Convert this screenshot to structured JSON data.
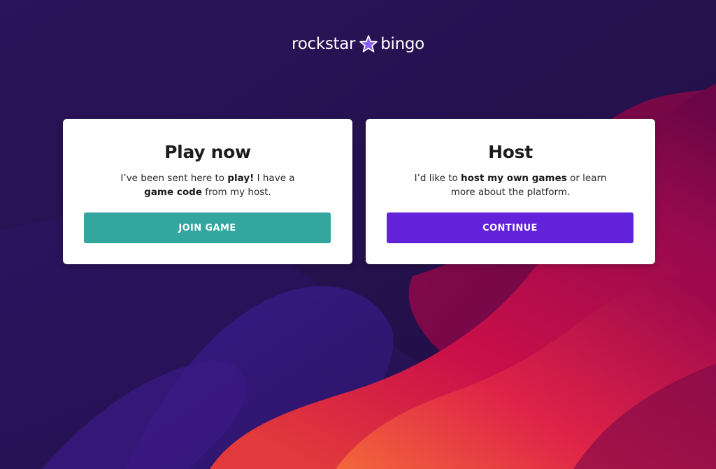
{
  "brand": {
    "name_left": "rockstar",
    "name_right": "bingo",
    "star_color": "#8a5cf6"
  },
  "cards": {
    "play": {
      "title": "Play now",
      "desc_parts": [
        "I’ve been sent here to ",
        "play!",
        " I have a ",
        "game code",
        " from my host."
      ],
      "button_label": "JOIN GAME",
      "button_color": "#33a69e"
    },
    "host": {
      "title": "Host",
      "desc_parts": [
        "I’d like to ",
        "host my own games",
        " or learn more about the platform."
      ],
      "button_label": "CONTINUE",
      "button_color": "#6122d9"
    }
  },
  "colors": {
    "background": "#25134f",
    "wave_purple": "#3d1c8c",
    "wave_red": "#d0123f",
    "wave_orange": "#f0603a"
  }
}
